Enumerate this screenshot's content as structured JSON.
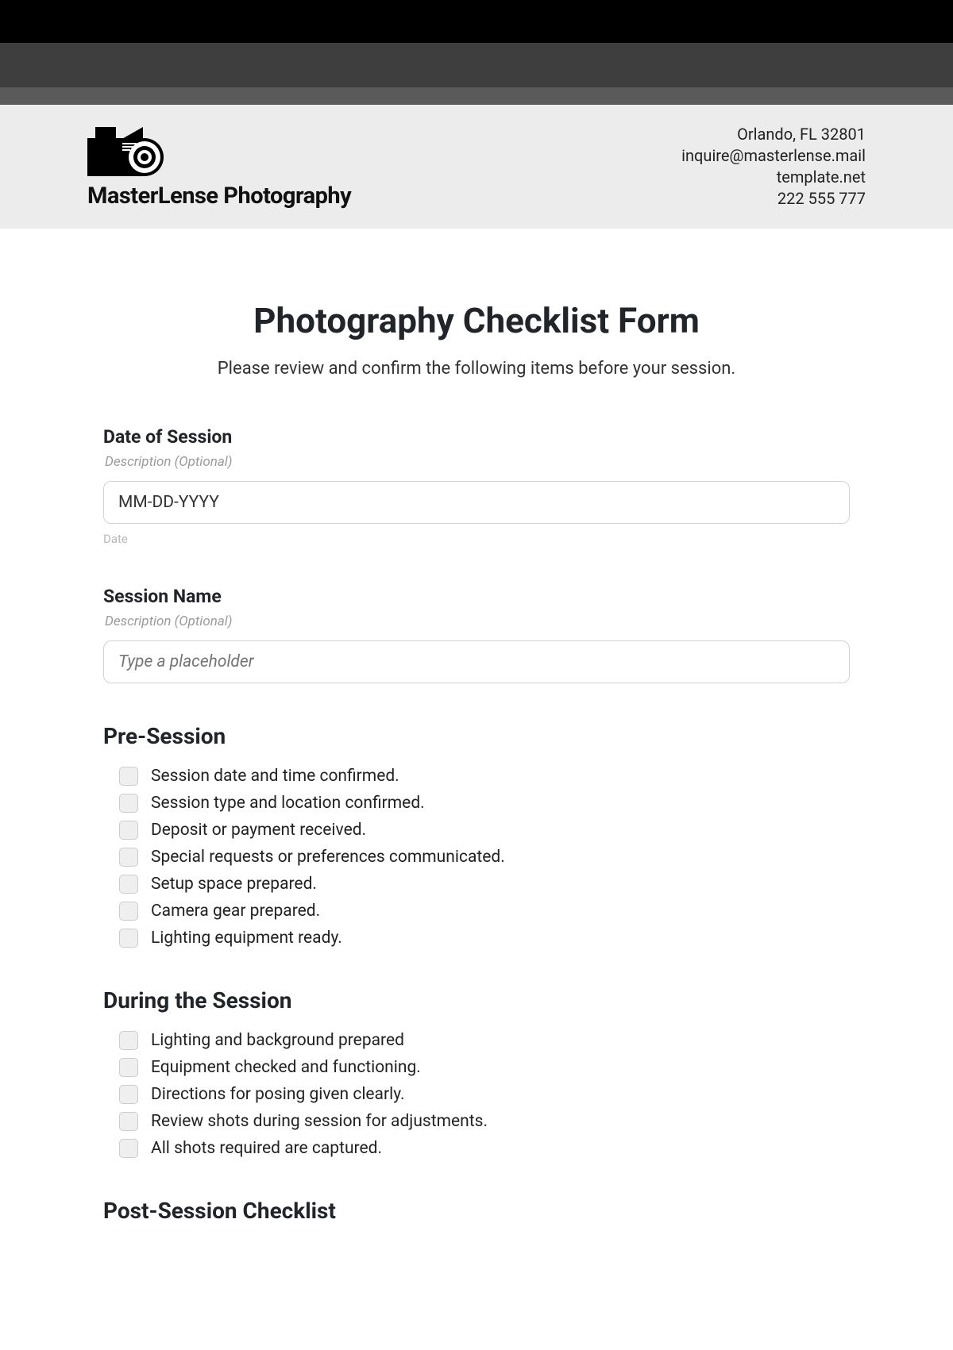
{
  "header": {
    "company": "MasterLense Photography",
    "address": "Orlando, FL 32801",
    "email": "inquire@masterlense.mail",
    "website": "template.net",
    "phone": "222 555 777"
  },
  "form": {
    "title": "Photography Checklist Form",
    "subtitle": "Please review and confirm the following items before your session."
  },
  "fields": {
    "date": {
      "label": "Date of Session",
      "desc": "Description (Optional)",
      "value": "MM-DD-YYYY",
      "helper": "Date"
    },
    "session_name": {
      "label": "Session Name",
      "desc": "Description (Optional)",
      "placeholder": "Type a placeholder"
    }
  },
  "sections": {
    "pre": {
      "title": "Pre-Session",
      "items": [
        "Session date and time confirmed.",
        "Session type and location confirmed.",
        "Deposit or payment received.",
        "Special requests or preferences communicated.",
        "Setup space prepared.",
        "Camera gear prepared.",
        "Lighting equipment ready."
      ]
    },
    "during": {
      "title": "During the Session",
      "items": [
        "Lighting and background prepared",
        "Equipment checked and functioning.",
        "Directions for posing given clearly.",
        "Review shots during session for adjustments.",
        "All shots required are captured."
      ]
    },
    "post": {
      "title": "Post-Session Checklist"
    }
  }
}
